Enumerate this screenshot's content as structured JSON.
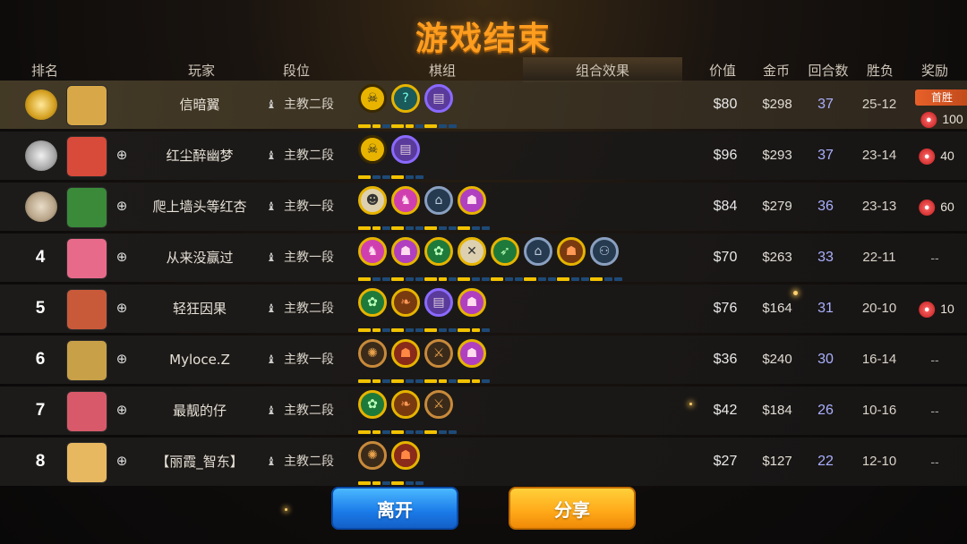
{
  "title": "游戏结束",
  "headers": {
    "rank": "排名",
    "player": "玩家",
    "tier": "段位",
    "lineup": "棋组",
    "synergy": "组合效果",
    "value": "价值",
    "gold": "金币",
    "rounds": "回合数",
    "winloss": "胜负",
    "reward": "奖励"
  },
  "rows": [
    {
      "rank": "",
      "medal": "gold",
      "name": "信暗翼",
      "tier": "主教二段",
      "value": "$80",
      "gold": "$298",
      "rounds": "37",
      "wl": "25-12",
      "reward": "100",
      "first_win": "首胜",
      "avatar_color": "#d8a848"
    },
    {
      "rank": "",
      "medal": "silver",
      "name": "红尘醉幽梦",
      "tier": "主教二段",
      "value": "$96",
      "gold": "$293",
      "rounds": "37",
      "wl": "23-14",
      "reward": "40",
      "avatar_color": "#d84a3a"
    },
    {
      "rank": "",
      "medal": "bronze",
      "name": "爬上墙头等红杏",
      "tier": "主教一段",
      "value": "$84",
      "gold": "$279",
      "rounds": "36",
      "wl": "23-13",
      "reward": "60",
      "avatar_color": "#3a8a3a"
    },
    {
      "rank": "4",
      "name": "从来没赢过",
      "tier": "主教一段",
      "value": "$70",
      "gold": "$263",
      "rounds": "33",
      "wl": "22-11",
      "reward": "--",
      "avatar_color": "#e86a8a"
    },
    {
      "rank": "5",
      "name": "轻狂因果",
      "tier": "主教二段",
      "value": "$76",
      "gold": "$164",
      "rounds": "31",
      "wl": "20-10",
      "reward": "10",
      "avatar_color": "#c85a3a"
    },
    {
      "rank": "6",
      "name": "Myloce.Z",
      "tier": "主教一段",
      "value": "$36",
      "gold": "$240",
      "rounds": "30",
      "wl": "16-14",
      "reward": "--",
      "avatar_color": "#c8a048"
    },
    {
      "rank": "7",
      "name": "最靓的仔",
      "tier": "主教二段",
      "value": "$42",
      "gold": "$184",
      "rounds": "26",
      "wl": "10-16",
      "reward": "--",
      "avatar_color": "#d85a6a"
    },
    {
      "rank": "8",
      "name": "【丽霞_智东】",
      "tier": "主教二段",
      "value": "$27",
      "gold": "$127",
      "rounds": "22",
      "wl": "12-10",
      "reward": "--",
      "avatar_color": "#e8b860"
    }
  ],
  "synergies": [
    [
      {
        "c": "c-gold",
        "g": "☠",
        "p": [
          1,
          1,
          0
        ]
      },
      {
        "c": "c-teal",
        "g": "?",
        "p": [
          1,
          1,
          0
        ]
      },
      {
        "c": "c-purple",
        "g": "▤",
        "p": [
          1,
          0,
          0
        ]
      }
    ],
    [
      {
        "c": "c-gold",
        "g": "☠",
        "p": [
          1,
          0,
          0
        ]
      },
      {
        "c": "c-purple",
        "g": "▤",
        "p": [
          1,
          0,
          0
        ]
      }
    ],
    [
      {
        "c": "c-beige",
        "g": "☻",
        "p": [
          1,
          1,
          0
        ]
      },
      {
        "c": "c-pink",
        "g": "♞",
        "p": [
          1,
          0,
          0
        ]
      },
      {
        "c": "c-steel",
        "g": "⌂",
        "p": [
          1,
          0,
          0
        ]
      },
      {
        "c": "c-magenta",
        "g": "☗",
        "p": [
          1,
          0,
          0
        ]
      }
    ],
    [
      {
        "c": "c-pink",
        "g": "♞",
        "p": [
          1,
          0,
          0
        ]
      },
      {
        "c": "c-magenta",
        "g": "☗",
        "p": [
          1,
          0,
          0
        ]
      },
      {
        "c": "c-green",
        "g": "✿",
        "p": [
          1,
          1,
          0
        ]
      },
      {
        "c": "c-beige",
        "g": "✕",
        "p": [
          1,
          0,
          0
        ]
      },
      {
        "c": "c-green",
        "g": "➶",
        "p": [
          1,
          0,
          0
        ]
      },
      {
        "c": "c-steel",
        "g": "⌂",
        "p": [
          1,
          0,
          0
        ]
      },
      {
        "c": "c-orange",
        "g": "☗",
        "p": [
          1,
          0,
          0
        ]
      },
      {
        "c": "c-steel",
        "g": "⚇",
        "p": [
          1,
          0,
          0
        ]
      }
    ],
    [
      {
        "c": "c-green",
        "g": "✿",
        "p": [
          1,
          1,
          0
        ]
      },
      {
        "c": "c-orange",
        "g": "❧",
        "p": [
          1,
          0,
          0
        ]
      },
      {
        "c": "c-purple",
        "g": "▤",
        "p": [
          1,
          0,
          0
        ]
      },
      {
        "c": "c-magenta",
        "g": "☗",
        "p": [
          1,
          1,
          0
        ]
      }
    ],
    [
      {
        "c": "c-bronze",
        "g": "✺",
        "p": [
          1,
          1,
          0
        ]
      },
      {
        "c": "c-red",
        "g": "☗",
        "p": [
          1,
          0,
          0
        ]
      },
      {
        "c": "c-bronze",
        "g": "⚔",
        "p": [
          1,
          1,
          0
        ]
      },
      {
        "c": "c-magenta",
        "g": "☗",
        "p": [
          1,
          1,
          0
        ]
      }
    ],
    [
      {
        "c": "c-green",
        "g": "✿",
        "p": [
          1,
          1,
          0
        ]
      },
      {
        "c": "c-orange",
        "g": "❧",
        "p": [
          1,
          0,
          0
        ]
      },
      {
        "c": "c-bronze",
        "g": "⚔",
        "p": [
          1,
          0,
          0
        ]
      }
    ],
    [
      {
        "c": "c-bronze",
        "g": "✺",
        "p": [
          1,
          1,
          0
        ]
      },
      {
        "c": "c-red",
        "g": "☗",
        "p": [
          1,
          0,
          0
        ]
      }
    ]
  ],
  "buttons": {
    "leave": "离开",
    "share": "分享"
  },
  "colors": {
    "title": "#ff9d1e",
    "rounds": "#aab0ff",
    "leave": "#1a7ae8",
    "share": "#ffa818"
  }
}
